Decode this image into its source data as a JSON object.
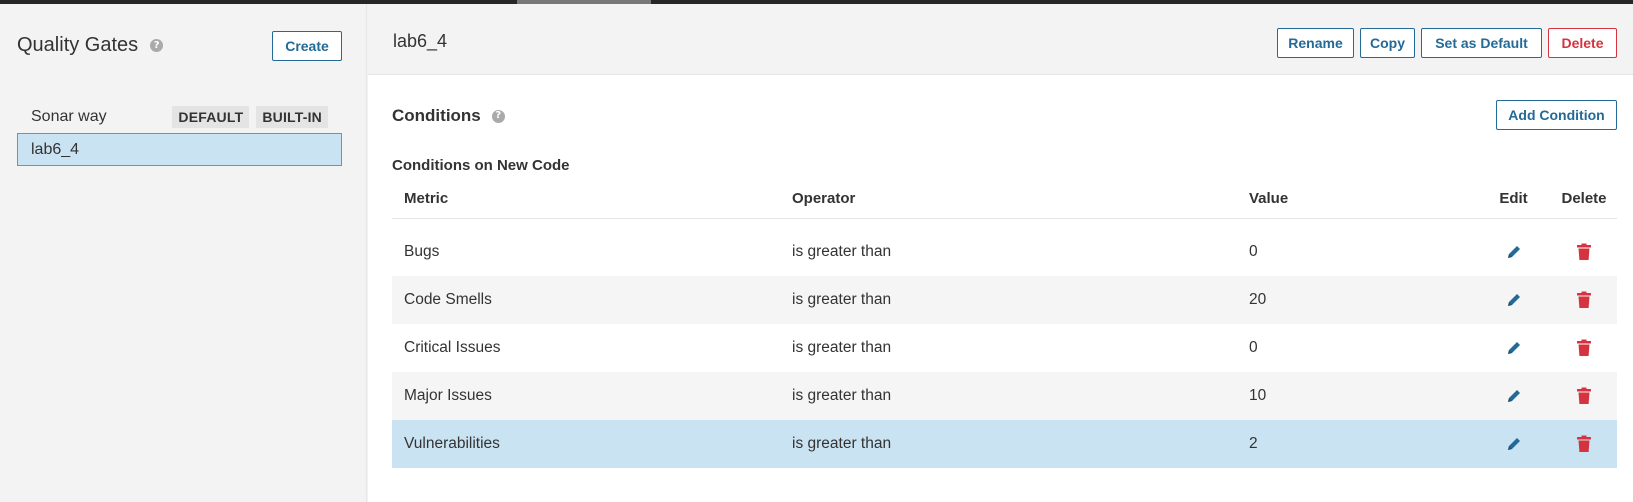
{
  "sidebar": {
    "title": "Quality Gates",
    "create_label": "Create",
    "gates": [
      {
        "name": "Sonar way",
        "badges": [
          "DEFAULT",
          "BUILT-IN"
        ]
      },
      {
        "name": "lab6_4",
        "badges": []
      }
    ]
  },
  "header": {
    "gate_name": "lab6_4",
    "actions": {
      "rename": "Rename",
      "copy": "Copy",
      "set_default": "Set as Default",
      "delete": "Delete"
    }
  },
  "conditions": {
    "title": "Conditions",
    "add_label": "Add Condition",
    "section_title": "Conditions on New Code",
    "columns": {
      "metric": "Metric",
      "operator": "Operator",
      "value": "Value",
      "edit": "Edit",
      "delete": "Delete"
    },
    "rows": [
      {
        "metric": "Bugs",
        "operator": "is greater than",
        "value": "0"
      },
      {
        "metric": "Code Smells",
        "operator": "is greater than",
        "value": "20"
      },
      {
        "metric": "Critical Issues",
        "operator": "is greater than",
        "value": "0"
      },
      {
        "metric": "Major Issues",
        "operator": "is greater than",
        "value": "10"
      },
      {
        "metric": "Vulnerabilities",
        "operator": "is greater than",
        "value": "2"
      }
    ]
  },
  "colors": {
    "accent": "#236a97",
    "danger": "#d4333f",
    "selected_bg": "#cae3f2"
  }
}
